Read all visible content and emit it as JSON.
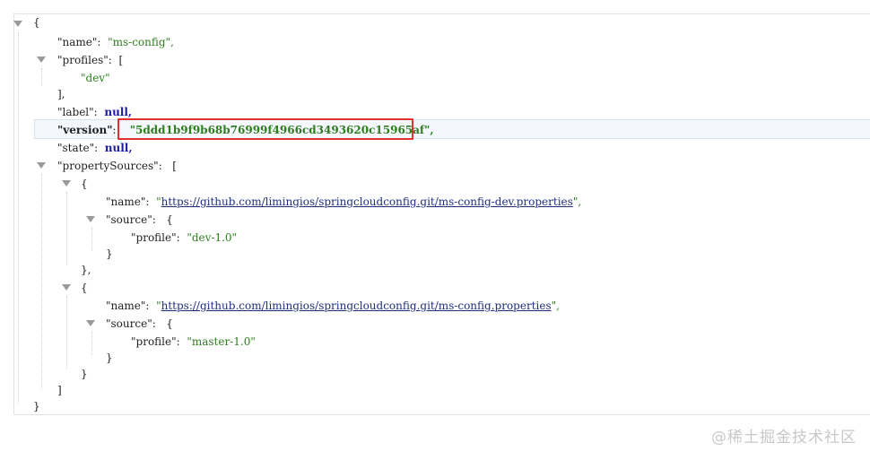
{
  "json": {
    "open_brace": "{",
    "close_brace": "}",
    "name_key": "\"name\"",
    "name_value": "\"ms-config\",",
    "profiles_key": "\"profiles\"",
    "profiles_open": "[",
    "profiles_item": "\"dev\"",
    "profiles_close": "],",
    "label_key": "\"label\"",
    "label_value": "null,",
    "version_key": "\"version\"",
    "version_value": "\"5ddd1b9f9b68b76999f4966cd3493620c15965af\",",
    "state_key": "\"state\"",
    "state_value": "null,",
    "property_sources_key": "\"propertySources\"",
    "property_sources_open": "[",
    "property_sources_close": "]",
    "sources": [
      {
        "open": "{",
        "name_key": "\"name\"",
        "name_quote_open": "\"",
        "name_url": "https://github.com/limingios/springcloudconfig.git/ms-config-dev.properties",
        "name_quote_close": "\",",
        "source_key": "\"source\"",
        "source_open": "{",
        "profile_key": "\"profile\"",
        "profile_value": "\"dev-1.0\"",
        "source_close": "}",
        "close": "},"
      },
      {
        "open": "{",
        "name_key": "\"name\"",
        "name_quote_open": "\"",
        "name_url": "https://github.com/limingios/springcloudconfig.git/ms-config.properties",
        "name_quote_close": "\",",
        "source_key": "\"source\"",
        "source_open": "{",
        "profile_key": "\"profile\"",
        "profile_value": "\"master-1.0\"",
        "source_close": "}",
        "close": "}"
      }
    ]
  },
  "colon": ":",
  "watermark": "@稀土掘金技术社区",
  "colors": {
    "string": "#2e7d1f",
    "null": "#1a1aa6",
    "highlight_border": "#e23030"
  }
}
